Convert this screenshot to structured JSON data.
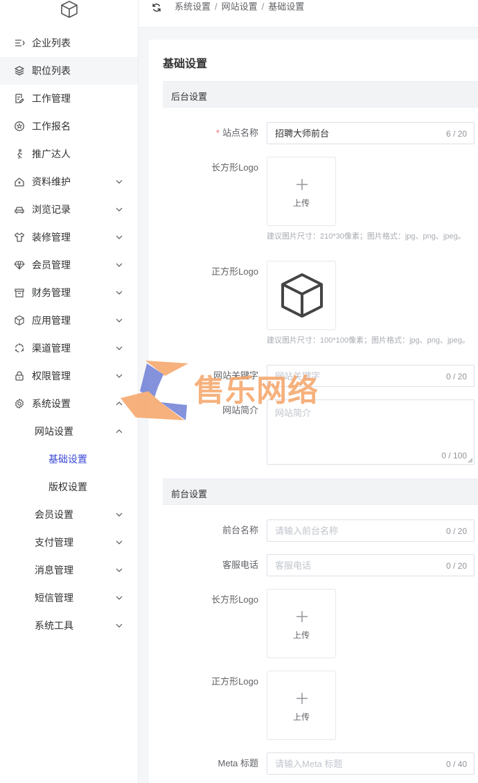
{
  "sidebar": {
    "items": [
      {
        "label": "企业列表",
        "icon": "list-indent-icon"
      },
      {
        "label": "职位列表",
        "icon": "layers-icon"
      },
      {
        "label": "工作管理",
        "icon": "document-edit-icon"
      },
      {
        "label": "工作报名",
        "icon": "star-badge-icon"
      },
      {
        "label": "推广达人",
        "icon": "walking-person-icon"
      },
      {
        "label": "资料维护",
        "icon": "home-star-icon"
      },
      {
        "label": "浏览记录",
        "icon": "car-icon"
      },
      {
        "label": "装修管理",
        "icon": "tshirt-icon"
      },
      {
        "label": "会员管理",
        "icon": "diamond-icon"
      },
      {
        "label": "财务管理",
        "icon": "trash-box-icon"
      },
      {
        "label": "应用管理",
        "icon": "cube-icon"
      },
      {
        "label": "渠道管理",
        "icon": "refresh-circle-icon"
      },
      {
        "label": "权限管理",
        "icon": "lock-icon"
      },
      {
        "label": "系统设置",
        "icon": "gear-icon"
      }
    ],
    "sub_items": {
      "website": "网站设置",
      "basic": "基础设置",
      "copyright": "版权设置",
      "member": "会员设置",
      "payment": "支付管理",
      "message": "消息管理",
      "sms": "短信管理",
      "tools": "系统工具"
    }
  },
  "breadcrumb": [
    "系统设置",
    "网站设置",
    "基础设置"
  ],
  "breadcrumb_sep": "/",
  "page_title": "基础设置",
  "sections": {
    "backend": "后台设置",
    "frontend": "前台设置"
  },
  "form": {
    "site_name": {
      "label": "站点名称",
      "required_mark": "*",
      "value": "招聘大师前台",
      "count": "6 / 20"
    },
    "rect_logo": {
      "label": "长方形Logo",
      "upload_text": "上传",
      "hint": "建议图片尺寸：210*30像素；图片格式：jpg、png、jpeg。"
    },
    "square_logo": {
      "label": "正方形Logo",
      "hint": "建议图片尺寸：100*100像素；图片格式：jpg、png、jpeg。"
    },
    "keywords": {
      "label": "网站关键字",
      "placeholder": "网站关键字",
      "count": "0 / 20"
    },
    "intro": {
      "label": "网站简介",
      "placeholder": "网站简介",
      "count": "0 / 100"
    },
    "front_name": {
      "label": "前台名称",
      "placeholder": "请输入前台名称",
      "count": "0 / 20"
    },
    "service_phone": {
      "label": "客服电话",
      "placeholder": "客服电话",
      "count": "0 / 20"
    },
    "front_rect_logo": {
      "label": "长方形Logo",
      "upload_text": "上传"
    },
    "front_square_logo": {
      "label": "正方形Logo",
      "upload_text": "上传"
    },
    "meta_title": {
      "label": "Meta 标题",
      "placeholder": "请输入Meta 标题",
      "count": "0 / 40"
    }
  },
  "watermark": {
    "text": "售乐网络"
  },
  "colors": {
    "accent": "#3a47d5",
    "required": "#f56c6c",
    "watermark_orange": "#f5a467",
    "watermark_blue": "#6f7fd6"
  }
}
